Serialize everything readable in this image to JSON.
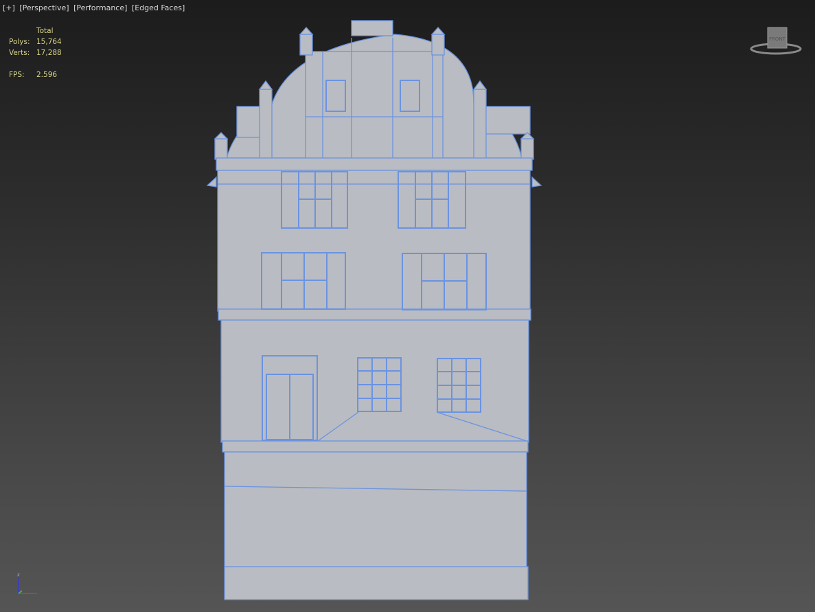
{
  "viewport": {
    "labels": [
      "[+]",
      "[Perspective]",
      "[Performance]",
      "[Edged Faces]"
    ]
  },
  "stats": {
    "header": "Total",
    "polys_label": "Polys:",
    "polys": "15,764",
    "verts_label": "Verts:",
    "verts": "17,288",
    "fps_label": "FPS:",
    "fps": "2.596"
  },
  "viewcube": {
    "face_label": "FRONT"
  },
  "axis": {
    "z": "z",
    "x": "x",
    "y": "y"
  },
  "colors": {
    "mesh": "#b9bcc2",
    "edges": "#6b93e0",
    "stats_text": "#d7d38a"
  }
}
